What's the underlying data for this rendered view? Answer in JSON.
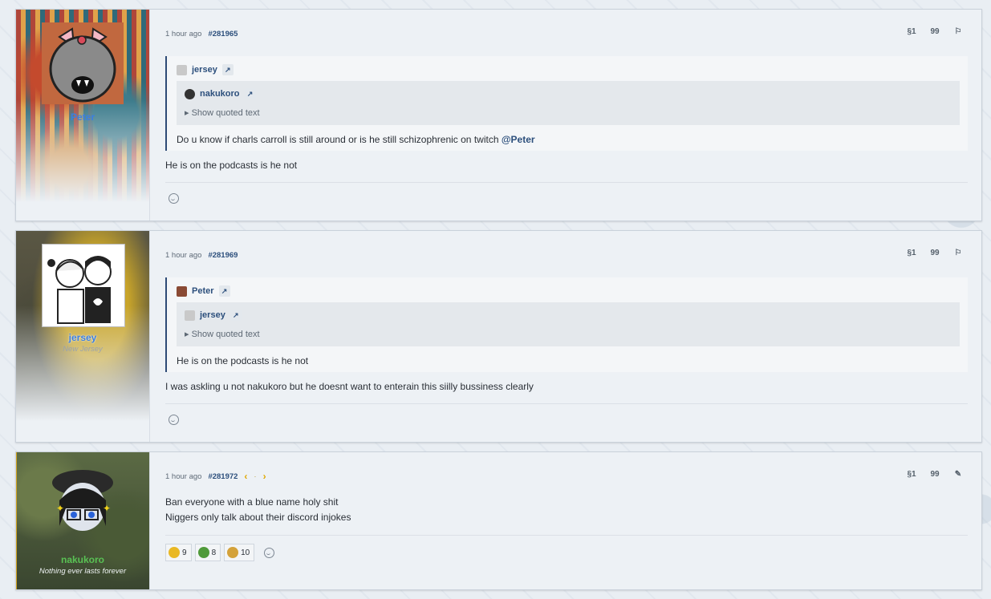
{
  "posts": [
    {
      "user": {
        "name": "Peter",
        "title": ""
      },
      "time": "1 hour ago",
      "post_number": "#281965",
      "quote": {
        "author": "jersey",
        "inner_author": "nakukoro",
        "show_quoted": "▸ Show quoted text",
        "text": "Do u know if charls carroll is still around or is he still schizophrenic on twitch ",
        "mention": "@Peter"
      },
      "body": [
        "He is on the podcasts is he not"
      ]
    },
    {
      "user": {
        "name": "jersey",
        "title": "New Jersey"
      },
      "time": "1 hour ago",
      "post_number": "#281969",
      "quote": {
        "author": "Peter",
        "inner_author": "jersey",
        "show_quoted": "▸ Show quoted text",
        "text": "He is on the podcasts is he not"
      },
      "body": [
        "I was askling u not nakukoro but he doesnt want to enterain this siilly bussiness clearly"
      ]
    },
    {
      "user": {
        "name": "nakukoro",
        "title": "Nothing ever lasts forever"
      },
      "time": "1 hour ago",
      "post_number": "#281972",
      "nav": {
        "prev": "‹",
        "sep": "·",
        "next": "›"
      },
      "body": [
        "Ban everyone with a blue name holy shit",
        "Niggers only talk about their discord injokes"
      ],
      "reactions": [
        {
          "emoji": "laugh-emoji",
          "count": "9",
          "color": "#e9b824"
        },
        {
          "emoji": "pepe-emoji",
          "count": "8",
          "color": "#4f9a3a"
        },
        {
          "emoji": "cookie-emoji",
          "count": "10",
          "color": "#d4a23a"
        }
      ]
    }
  ],
  "icons": {
    "share": "§1",
    "quote": "99",
    "flag": "⚐",
    "edit": "✎",
    "link": "↗"
  }
}
